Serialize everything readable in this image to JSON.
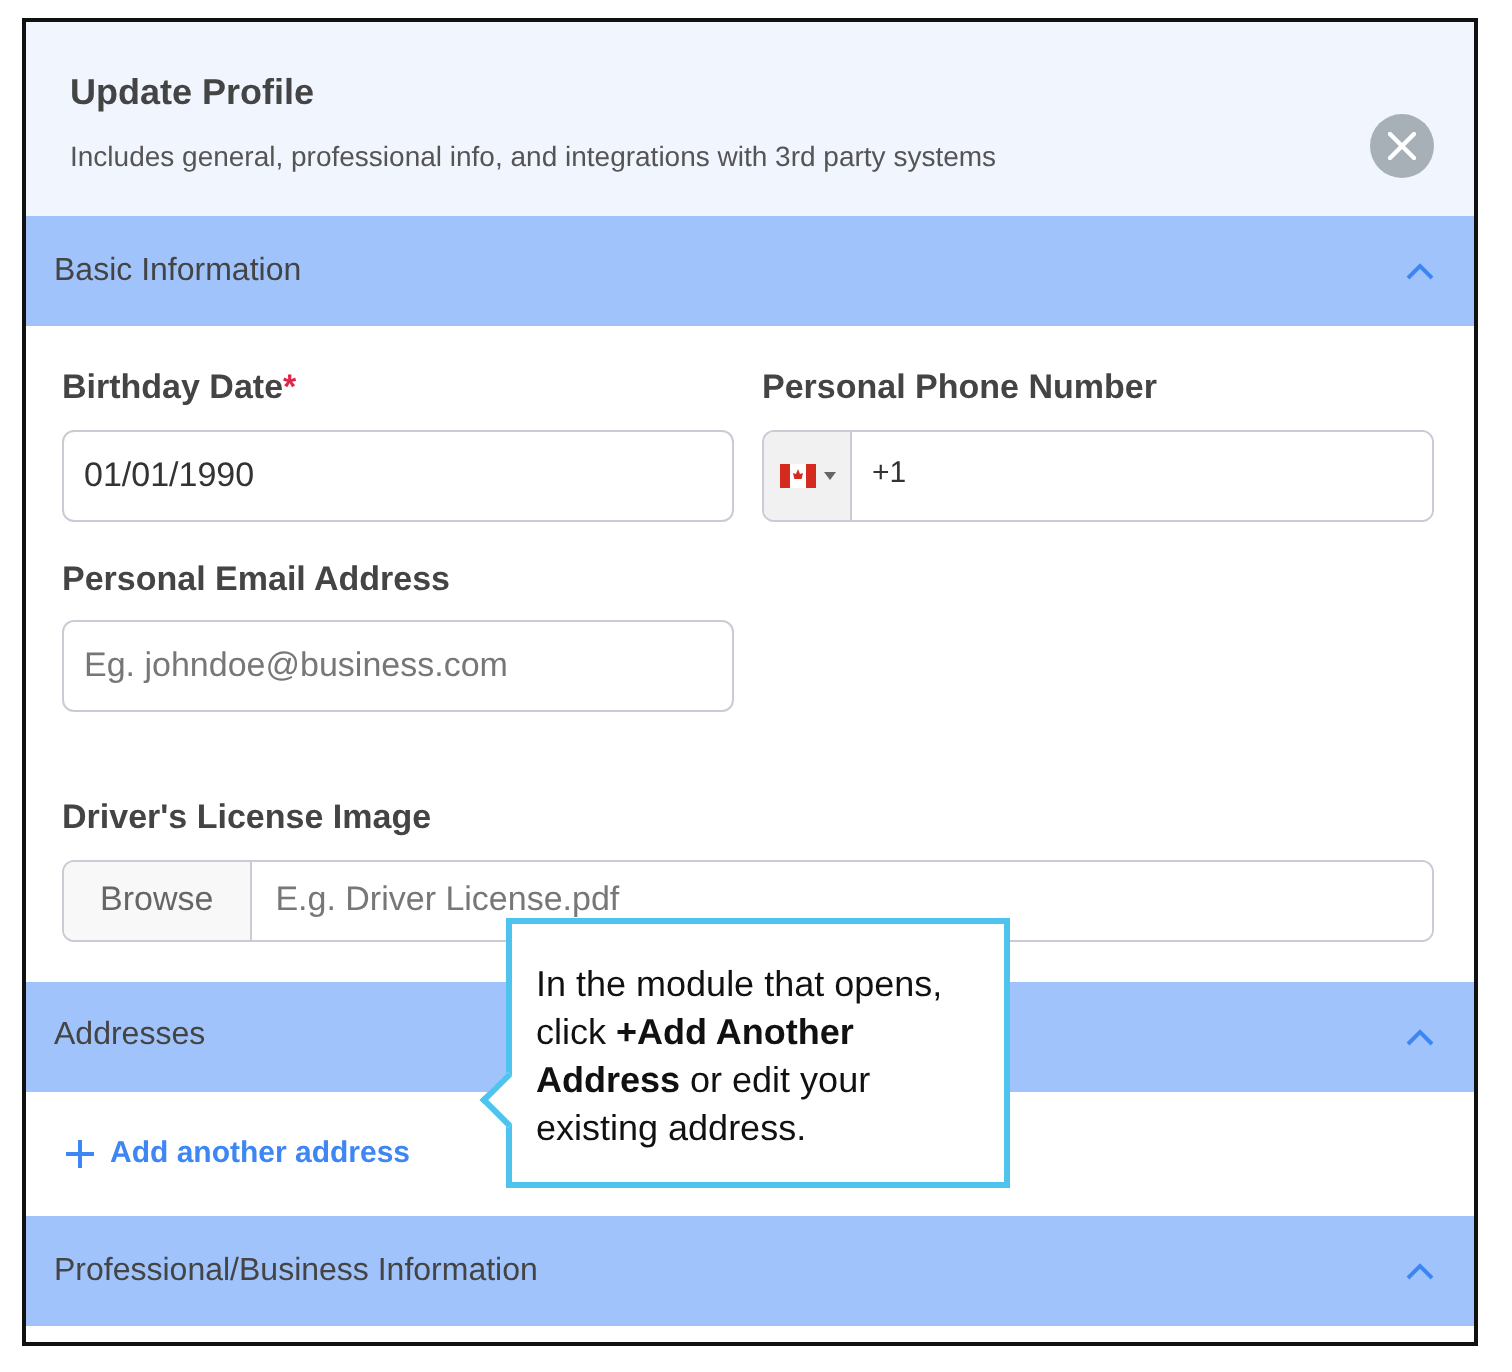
{
  "dialog": {
    "title": "Update Profile",
    "subtitle": "Includes general, professional info, and integrations with 3rd party systems"
  },
  "sections": [
    {
      "title": "Basic Information",
      "expanded": true,
      "kind": "fields",
      "fields": [
        {
          "kind": "text",
          "label": "Birthday Date",
          "required_mark": "*",
          "value": "01/01/1990"
        },
        {
          "kind": "phone",
          "label": "Personal Phone Number",
          "value": "+1"
        },
        {
          "kind": "text",
          "label": "Personal Email Address",
          "placeholder": "Eg. johndoe@business.com"
        },
        {
          "kind": "file",
          "label": "Driver's License Image",
          "button": "Browse",
          "placeholder": "E.g. Driver License.pdf"
        }
      ]
    },
    {
      "title": "Addresses",
      "expanded": true,
      "kind": "link",
      "link": "Add another address"
    },
    {
      "title": "Professional/Business Information",
      "expanded": true,
      "kind": "empty"
    }
  ],
  "callout": {
    "text": "In the module that opens, click **+Add Another Address** or edit your existing address."
  }
}
